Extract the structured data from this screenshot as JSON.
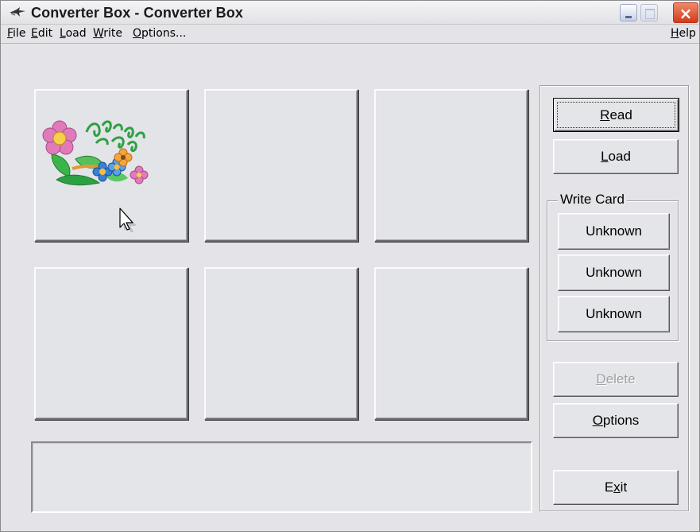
{
  "window": {
    "title": "Converter Box - Converter Box",
    "close_glyph": "×"
  },
  "menu": {
    "items": [
      "File",
      "Edit",
      "Load",
      "Write",
      "Options..."
    ],
    "help": "Help"
  },
  "slots": [
    {
      "name": "card-slot-1",
      "content": "flower-clipart"
    },
    {
      "name": "card-slot-2",
      "content": ""
    },
    {
      "name": "card-slot-3",
      "content": ""
    },
    {
      "name": "card-slot-4",
      "content": ""
    },
    {
      "name": "card-slot-5",
      "content": ""
    },
    {
      "name": "card-slot-6",
      "content": ""
    }
  ],
  "buttons": {
    "read": "Read",
    "load": "Load",
    "write_card_label": "Write Card",
    "write": [
      "Unknown",
      "Unknown",
      "Unknown"
    ],
    "delete": "Delete",
    "options": "Options",
    "exit_prefix": "E",
    "exit_underlined": "x",
    "exit_suffix": "it"
  },
  "status_text": "",
  "colors": {
    "window_bg": "#e4e4e8",
    "close_button": "#d33a18",
    "flower_pink": "#e07ab8",
    "flower_blue": "#3a7fd0",
    "leaf_green": "#2ea044"
  }
}
